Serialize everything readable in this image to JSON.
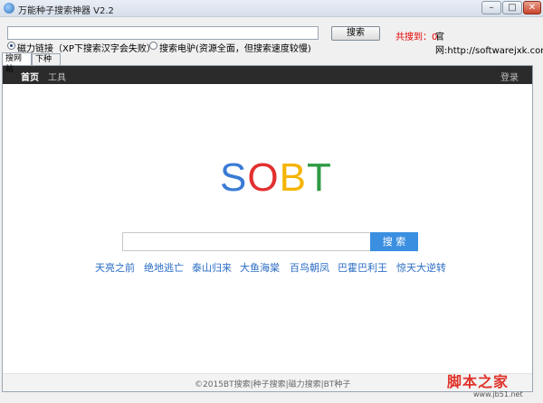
{
  "window": {
    "title": "万能种子搜索神器 V2.2",
    "min_glyph": "–",
    "max_glyph": "□",
    "close_glyph": "✕"
  },
  "toolbar": {
    "search_value": "",
    "search_button": "搜索",
    "found_label": "共搜到：0",
    "official_site": "官网:http://softwarejxk.com",
    "radio_magnet_label": "磁力链接（XP下搜索汉字会失败）",
    "radio_ed2k_label": "搜索电驴(资源全面，但搜索速度较慢)",
    "selected_mode": "magnet"
  },
  "tabs": [
    {
      "label": "搜网站",
      "active": true
    },
    {
      "label": "下种子",
      "active": false
    }
  ],
  "site": {
    "nav": {
      "home": "首页",
      "tools": "工具",
      "login": "登录"
    },
    "logo": {
      "s": "S",
      "o": "O",
      "b": "B",
      "t": "T"
    },
    "logo_colors": {
      "s": "#3a7bd5",
      "o": "#e2302f",
      "b": "#f5b400",
      "t": "#2f9a44"
    },
    "search_placeholder": "",
    "search_button": "搜 索",
    "hot_links": [
      "天亮之前",
      "绝地逃亡",
      "泰山归来",
      "大鱼海棠",
      "百鸟朝凤",
      "巴霍巴利王",
      "惊天大逆转"
    ],
    "footer": "©2015BT搜索|种子搜索|磁力搜索|BT种子"
  },
  "watermark": {
    "main": "脚本之家",
    "url": "www.jb51.net"
  },
  "colors": {
    "accent_blue": "#3b8fe0",
    "found_red": "#e60000",
    "link_blue": "#2b6cc4",
    "nav_dark": "#2b2b2b"
  }
}
